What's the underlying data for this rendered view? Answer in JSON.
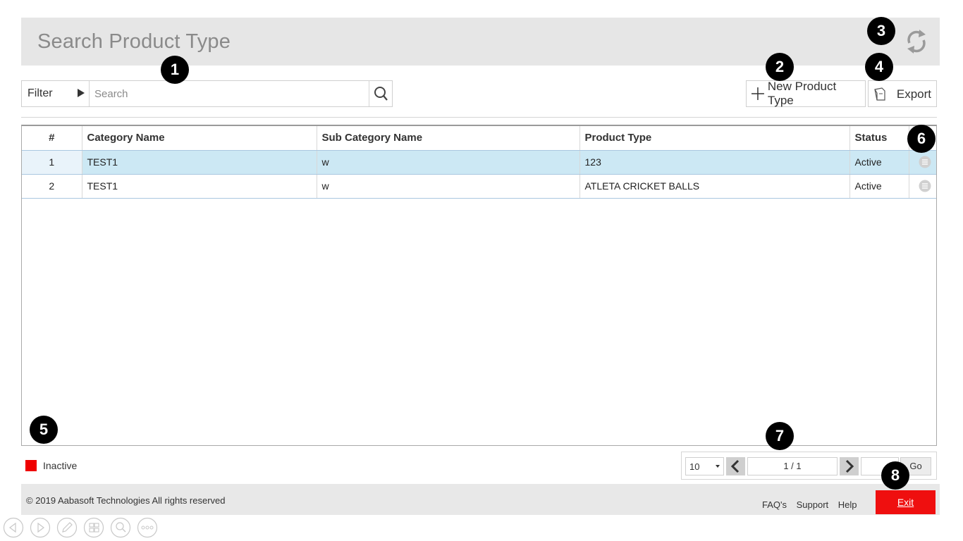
{
  "header": {
    "title": "Search Product Type"
  },
  "toolbar": {
    "filter_label": "Filter",
    "search_placeholder": "Search",
    "search_value": "",
    "new_label": "New Product Type",
    "export_label": "Export"
  },
  "table": {
    "columns": [
      "#",
      "Category Name",
      "Sub Category Name",
      "Product Type",
      "Status",
      ""
    ],
    "rows": [
      {
        "num": "1",
        "category": "TEST1",
        "subcategory": "w",
        "product_type": "123",
        "status": "Active"
      },
      {
        "num": "2",
        "category": "TEST1",
        "subcategory": "w",
        "product_type": "ATLETA CRICKET BALLS",
        "status": "Active"
      }
    ]
  },
  "legend": {
    "label": "Inactive",
    "color": "#ef0000"
  },
  "pager": {
    "page_size": "10",
    "page_info": "1 / 1",
    "goto_value": "",
    "go_label": "Go"
  },
  "footer": {
    "copyright": "© 2019 Aabasoft Technologies All rights reserved",
    "links": [
      "FAQ's",
      "Support",
      "Help"
    ],
    "exit_label": "Exit"
  },
  "callouts": [
    "1",
    "2",
    "3",
    "4",
    "5",
    "6",
    "7",
    "8"
  ],
  "slide_controls": [
    "previous-icon",
    "next-icon",
    "pen-icon",
    "slides-icon",
    "zoom-icon",
    "more-icon"
  ]
}
